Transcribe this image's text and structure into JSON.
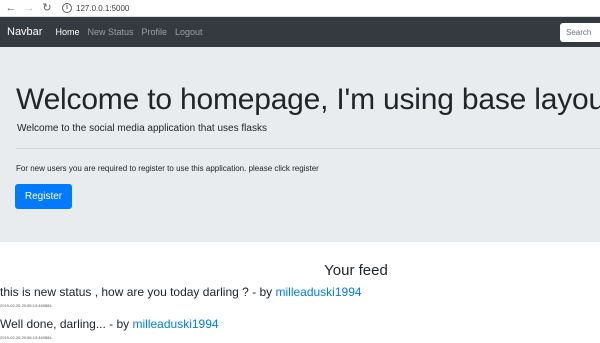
{
  "browser": {
    "back_icon": "arrow-left-icon",
    "forward_icon": "arrow-right-icon",
    "reload_icon": "reload-icon",
    "url": "127.0.0.1:5000"
  },
  "navbar": {
    "brand": "Navbar",
    "links": [
      {
        "label": "Home",
        "active": true
      },
      {
        "label": "New Status",
        "active": false
      },
      {
        "label": "Profile",
        "active": false
      },
      {
        "label": "Logout",
        "active": false
      }
    ],
    "search_placeholder": "Search"
  },
  "jumbotron": {
    "title": "Welcome to homepage, I'm using base layout",
    "lead": "Welcome to the social media application that uses flasks",
    "text": "For new users you are required to register to use this application. please click register",
    "register_label": "Register"
  },
  "feed": {
    "title": "Your feed",
    "by_text": " - by ",
    "items": [
      {
        "status": "this is new status , how are you today darling ?",
        "author": "milleaduski1994",
        "timestamp": "2019-02-25 20:55:13.460884"
      },
      {
        "status": "Well done, darling...",
        "author": "milleaduski1994",
        "timestamp": "2019-02-26 20:56:13.460884"
      }
    ]
  },
  "colors": {
    "navbar_bg": "#343a40",
    "jumbotron_bg": "#e9ecef",
    "primary": "#007bff"
  }
}
